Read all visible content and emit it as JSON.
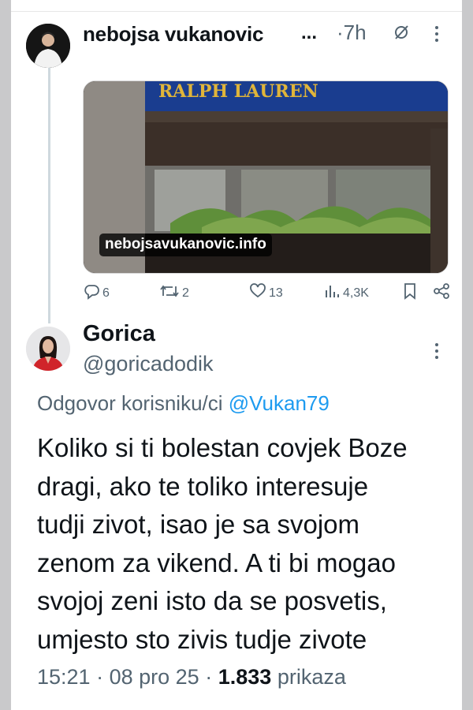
{
  "tweet": {
    "author_name": "nebojsa vukanovic",
    "ellipsis": "...",
    "time": "·7h",
    "watermark": "nebojsavukanovic.info",
    "sign_text": "RALPH LAUREN",
    "replies": "6",
    "retweets": "2",
    "likes": "13",
    "views": "4,3K"
  },
  "reply": {
    "author_name": "Gorica",
    "handle": "@goricadodik",
    "replying_prefix": "Odgovor korisniku/ci",
    "replying_mention": "@Vukan79",
    "body_lines": [
      "Koliko si ti bolestan covjek Boze",
      "dragi, ako te toliko interesuje",
      "tudji zivot, isao je sa svojom",
      "zenom za vikend. A ti bi mogao",
      "svojoj zeni isto da se posvetis,",
      "umjesto sto zivis tudje zivote"
    ],
    "timestamp": "15:21",
    "date": "08 pro 25",
    "views_count": "1.833",
    "views_label": "prikaza"
  },
  "colors": {
    "text": "#0f1419",
    "secondary": "#536471",
    "link": "#1d9bf0",
    "background_outer": "#c9c9cb"
  },
  "icons": [
    "slash-circle-icon",
    "more-icon",
    "reply-icon",
    "retweet-icon",
    "like-icon",
    "views-icon",
    "bookmark-icon",
    "share-icon"
  ]
}
